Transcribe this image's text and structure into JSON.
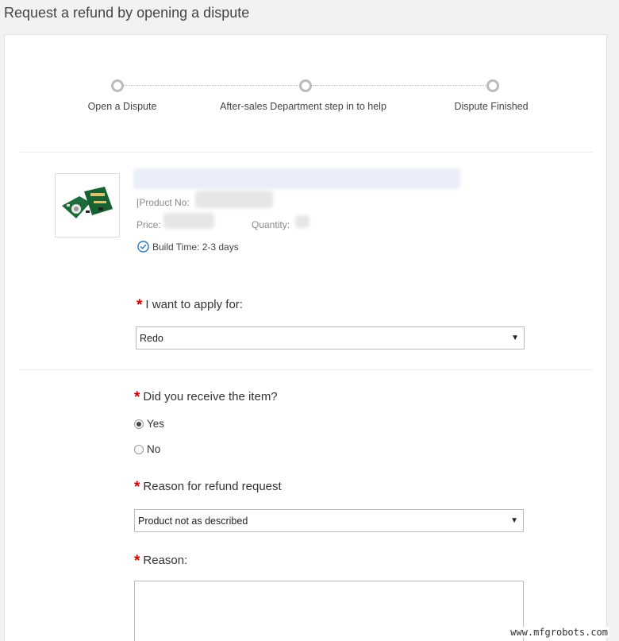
{
  "page": {
    "title": "Request a refund by opening a dispute"
  },
  "steps": [
    {
      "label": "Open a Dispute"
    },
    {
      "label": "After-sales Department step in to help"
    },
    {
      "label": "Dispute Finished"
    }
  ],
  "product": {
    "product_no_label": "[Product No:",
    "price_label": "Price:",
    "quantity_label": "Quantity:",
    "build_time": "Build Time: 2-3 days"
  },
  "apply": {
    "label": "I want to apply for:",
    "selected": "Redo"
  },
  "received": {
    "label": "Did you receive the item?",
    "options": [
      {
        "label": "Yes",
        "checked": true
      },
      {
        "label": "No",
        "checked": false
      }
    ]
  },
  "refund_reason": {
    "label": "Reason for refund request",
    "selected": "Product not as described"
  },
  "reason": {
    "label": "Reason:"
  },
  "required_mark": "*",
  "caret": "▼",
  "watermark": "www.mfgrobots.com",
  "colors": {
    "required": "#d40000",
    "accent": "#2a7ab8"
  }
}
